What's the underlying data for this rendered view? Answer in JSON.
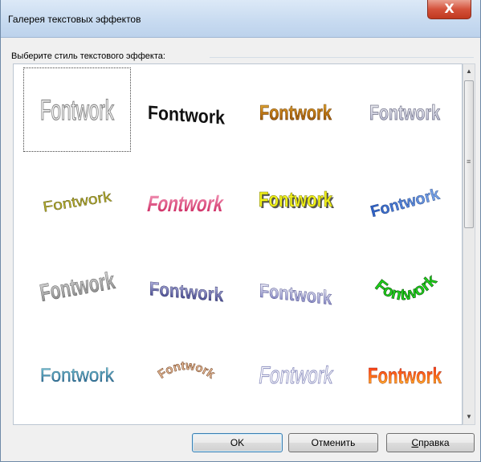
{
  "window": {
    "title": "Галерея текстовых эффектов",
    "close_label": "X"
  },
  "group_label": "Выберите стиль текстового эффекта:",
  "gallery": {
    "items": [
      {
        "text": "Fontwork",
        "style": "outline-gray",
        "selected": true
      },
      {
        "text": "Fontwork",
        "style": "arched-black"
      },
      {
        "text": "Fontwork",
        "style": "gold-orange"
      },
      {
        "text": "Fontwork",
        "style": "silver-outline"
      },
      {
        "text": "Fontwork",
        "style": "olive-italic-slant"
      },
      {
        "text": "Fontwork",
        "style": "pink-perspective"
      },
      {
        "text": "Fontwork",
        "style": "yellow-bold"
      },
      {
        "text": "Fontwork",
        "style": "blue-slant"
      },
      {
        "text": "Fontwork",
        "style": "gray-3d-slant"
      },
      {
        "text": "Fontwork",
        "style": "blue-wave"
      },
      {
        "text": "Fontwork",
        "style": "lavender-wave"
      },
      {
        "text": "Fontwork",
        "style": "green-arch"
      },
      {
        "text": "Fontwork",
        "style": "teal-serif"
      },
      {
        "text": "Fontwork",
        "style": "brown-arc"
      },
      {
        "text": "Fontwork",
        "style": "white-outline-perspective"
      },
      {
        "text": "Fontwork",
        "style": "red-orange-bold"
      }
    ]
  },
  "buttons": {
    "ok": "OK",
    "cancel": "Отменить",
    "help_underlined": "С",
    "help_rest": "правка"
  },
  "colors": {
    "accent": "#3c7fb1",
    "close": "#c7432c",
    "titlebar": "#c7daf0"
  }
}
